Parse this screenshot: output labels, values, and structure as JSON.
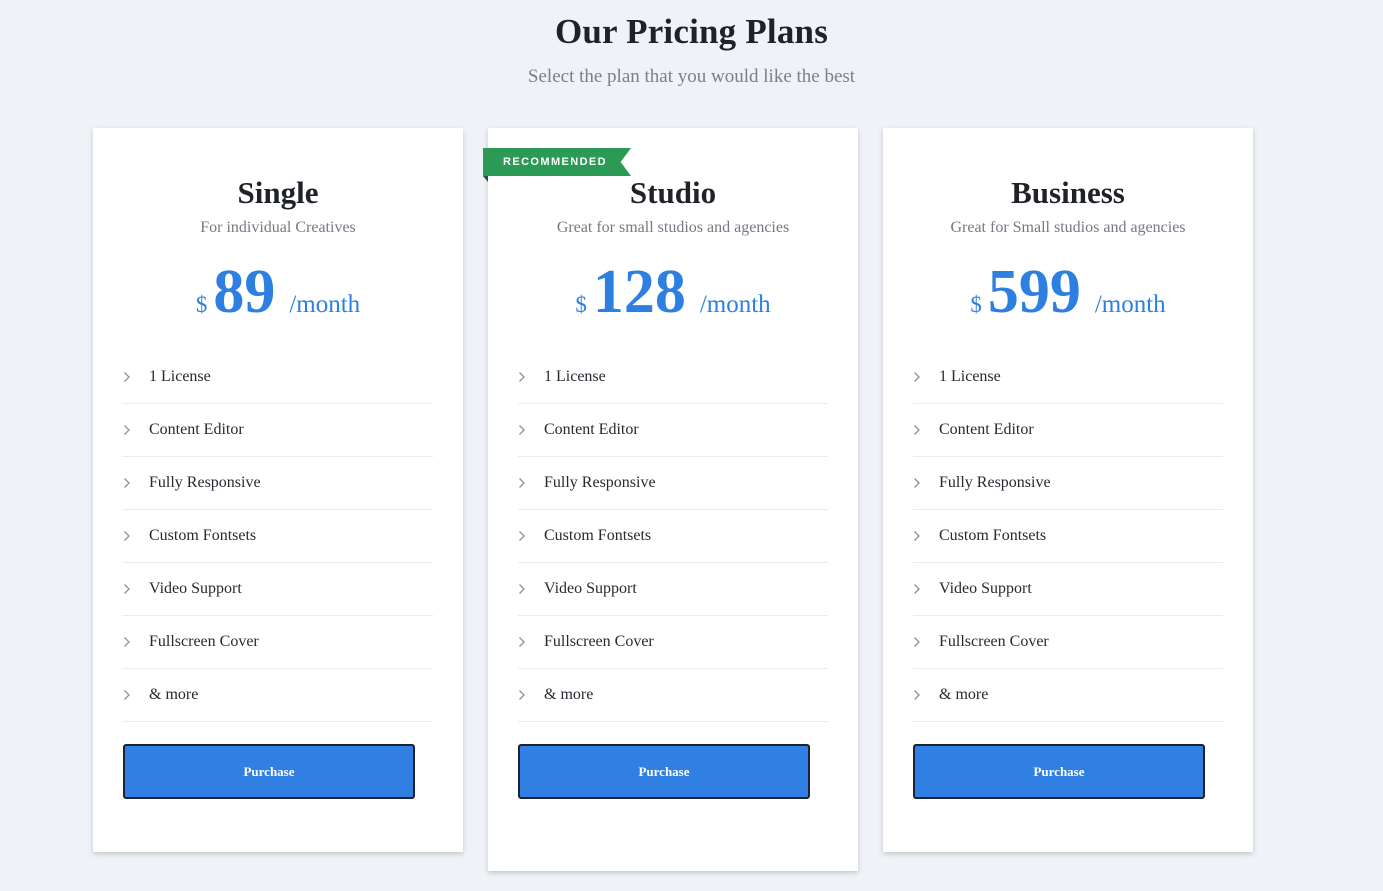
{
  "header": {
    "title": "Our Pricing Plans",
    "subtitle": "Select the plan that you would like the best"
  },
  "plans": [
    {
      "name": "Single",
      "description": "For individual Creatives",
      "currency": "$",
      "amount": "89",
      "period": "/month",
      "features": [
        "1 License",
        "Content Editor",
        "Fully Responsive",
        "Custom Fontsets",
        "Video Support",
        "Fullscreen Cover",
        "& more"
      ],
      "button_label": "Purchase"
    },
    {
      "name": "Studio",
      "description": "Great for small studios and agencies",
      "currency": "$",
      "amount": "128",
      "period": "/month",
      "badge": "RECOMMENDED",
      "features": [
        "1 License",
        "Content Editor",
        "Fully Responsive",
        "Custom Fontsets",
        "Video Support",
        "Fullscreen Cover",
        "& more"
      ],
      "button_label": "Purchase"
    },
    {
      "name": "Business",
      "description": "Great for Small studios and agencies",
      "currency": "$",
      "amount": "599",
      "period": "/month",
      "features": [
        "1 License",
        "Content Editor",
        "Fully Responsive",
        "Custom Fontsets",
        "Video Support",
        "Fullscreen Cover",
        "& more"
      ],
      "button_label": "Purchase"
    }
  ],
  "icons": {
    "feature_bullet": "chevron-right-icon"
  },
  "colors": {
    "background": "#eff2f7",
    "price": "#2d7fe0",
    "button": "#2f80e2",
    "badge": "#2a9a55"
  }
}
